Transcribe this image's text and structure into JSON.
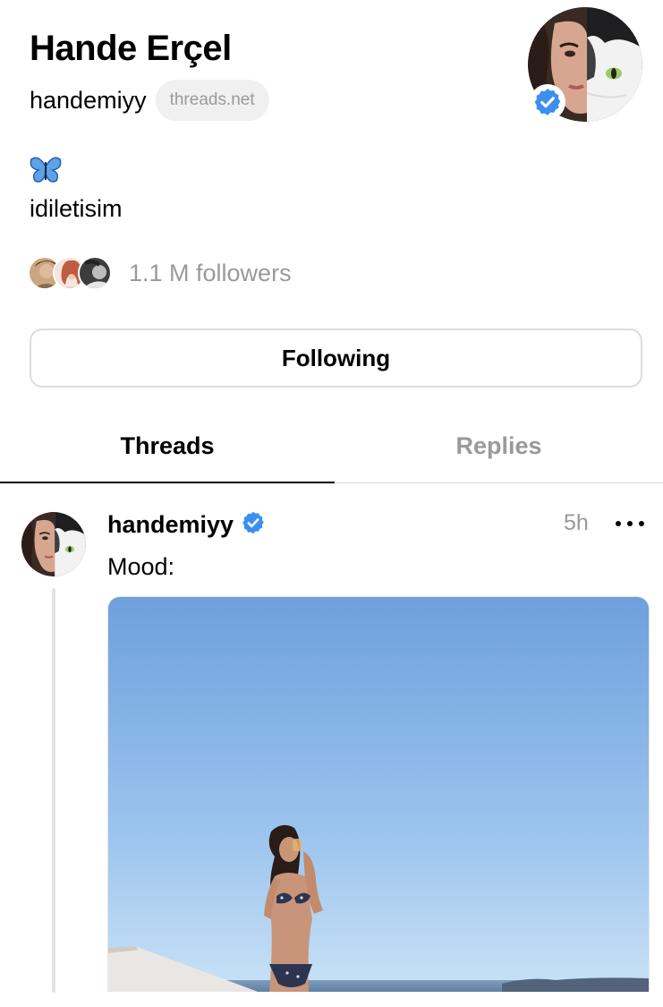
{
  "profile": {
    "name": "Hande Erçel",
    "handle": "handemiyy",
    "domain": "threads.net",
    "bio_emoji": "butterfly",
    "bio": "idiletisim",
    "followers_label": "1.1 M followers",
    "verified": true,
    "follow_button_label": "Following"
  },
  "tabs": [
    {
      "label": "Threads",
      "active": true
    },
    {
      "label": "Replies",
      "active": false
    }
  ],
  "post": {
    "username": "handemiyy",
    "time": "5h",
    "text": "Mood:",
    "verified": true
  },
  "colors": {
    "verified_blue": "#3b8ff0",
    "muted_text": "#9a9a9a",
    "border": "#dcdcdc",
    "sky_top": "#6ea0dc",
    "sky_bottom": "#c9e2f6"
  },
  "icons": {
    "verified": "verified-check-icon",
    "more": "more-horizontal-icon",
    "bio": "butterfly-icon"
  }
}
